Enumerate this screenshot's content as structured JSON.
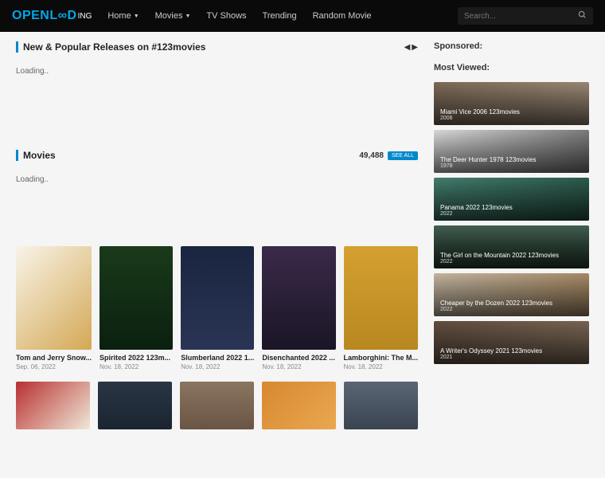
{
  "logo": {
    "main": "OPENL∞D",
    "sub": "ing"
  },
  "nav": {
    "home": "Home",
    "movies": "Movies",
    "tvshows": "TV Shows",
    "trending": "Trending",
    "random": "Random Movie"
  },
  "search": {
    "placeholder": "Search..."
  },
  "sections": {
    "newPopular": {
      "title": "New & Popular Releases on #123movies",
      "loading": "Loading.."
    },
    "movies": {
      "title": "Movies",
      "count": "49,488",
      "seeAll": "SEE ALL",
      "loading": "Loading.."
    }
  },
  "movieGrid": [
    {
      "title": "Tom and Jerry Snow...",
      "date": "Sep. 06, 2022"
    },
    {
      "title": "Spirited 2022 123m...",
      "date": "Nov. 18, 2022"
    },
    {
      "title": "Slumberland 2022 1...",
      "date": "Nov. 18, 2022"
    },
    {
      "title": "Disenchanted 2022 ...",
      "date": "Nov. 18, 2022"
    },
    {
      "title": "Lamborghini: The M...",
      "date": "Nov. 18, 2022"
    }
  ],
  "sidebar": {
    "sponsored": "Sponsored:",
    "mostViewed": "Most Viewed:",
    "items": [
      {
        "title": "Miami Vice 2006 123movies",
        "year": "2006"
      },
      {
        "title": "The Deer Hunter 1978 123movies",
        "year": "1978"
      },
      {
        "title": "Panama 2022 123movies",
        "year": "2022"
      },
      {
        "title": "The Girl on the Mountain 2022 123movies",
        "year": "2022"
      },
      {
        "title": "Cheaper by the Dozen 2022 123movies",
        "year": "2022"
      },
      {
        "title": "A Writer's Odyssey 2021 123movies",
        "year": "2021"
      }
    ]
  }
}
